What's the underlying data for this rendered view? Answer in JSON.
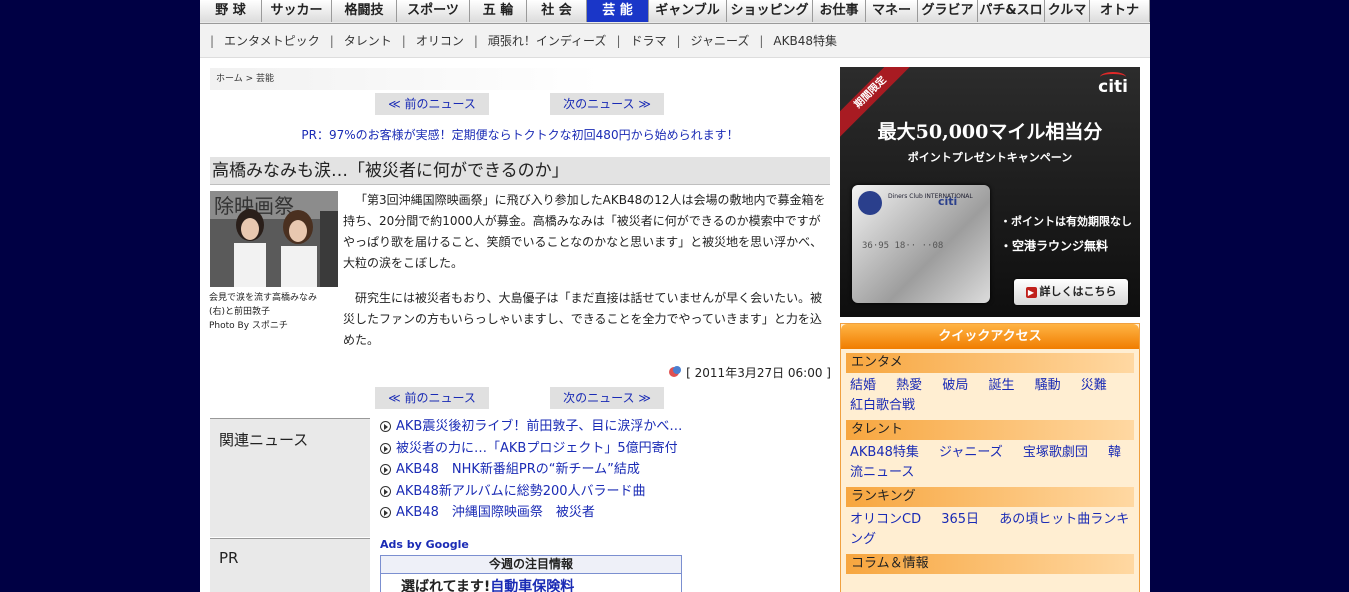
{
  "top_nav": [
    {
      "label": "野 球",
      "w": 62
    },
    {
      "label": "サッカー",
      "w": 70
    },
    {
      "label": "格闘技",
      "w": 65
    },
    {
      "label": "スポーツ",
      "w": 73
    },
    {
      "label": "五 輪",
      "w": 57
    },
    {
      "label": "社 会",
      "w": 60
    },
    {
      "label": "芸 能",
      "w": 62,
      "active": true
    },
    {
      "label": "ギャンブル",
      "w": 78
    },
    {
      "label": "ショッピング",
      "w": 86
    },
    {
      "label": "お仕事",
      "w": 53
    },
    {
      "label": "マネー",
      "w": 52
    },
    {
      "label": "グラビア",
      "w": 60
    },
    {
      "label": "パチ&スロ",
      "w": 67
    },
    {
      "label": "クルマ",
      "w": 45
    },
    {
      "label": "オトナ",
      "w": 60
    }
  ],
  "sub_nav": [
    "エンタメトピック",
    "タレント",
    "オリコン",
    "頑張れ！インディーズ",
    "ドラマ",
    "ジャニーズ",
    "AKB48特集"
  ],
  "breadcrumb": {
    "home": "ホーム",
    "sep": " > ",
    "current": "芸能"
  },
  "nav": {
    "prev": "≪ 前のニュース",
    "next": "次のニュース ≫"
  },
  "pr_line": "PR：97%のお客様が実感！定期便ならトクトクな初回480円から始められます！",
  "article": {
    "headline": "高橋みなみも涙…「被災者に何ができるのか」",
    "caption_1": "会見で涙を流す高橋みなみ",
    "caption_2": "(右)と前田敦子",
    "credit": "Photo By スポニチ",
    "para_1": "「第3回沖縄国際映画祭」に飛び入り参加したAKB48の12人は会場の敷地内で募金箱を持ち、20分間で約1000人が募金。高橋みなみは「被災者に何ができるのか模索中ですがやっぱり歌を届けること、笑顔でいることなのかなと思います」と被災地を思い浮かべ、大粒の涙をこぼした。",
    "para_2": "研究生には被災者もおり、大島優子は「まだ直接は話せていませんが早く会いたい。被災したファンの方もいらっしゃいますし、できることを全力でやっていきます」と力を込めた。",
    "date": "[ 2011年3月27日 06:00 ]"
  },
  "related": {
    "title": "関連ニュース",
    "items": [
      "AKB震災後初ライブ！前田敦子、目に涙浮かべ…",
      "被災者の力に…「AKBプロジェクト」5億円寄付",
      "AKB48　NHK新番組PRの“新チーム”結成",
      "AKB48新アルバムに総勢200人バラード曲",
      "AKB48　沖縄国際映画祭　被災者"
    ]
  },
  "pr_box": {
    "title": "PR"
  },
  "ads": {
    "by": "Ads by Google",
    "header": "今週の注目情報",
    "text_plain": "選ばれてます!",
    "text_link": "自動車保険料"
  },
  "banner": {
    "ribbon": "期間限定",
    "brand": "citi",
    "title": "最大50,000マイル相当分",
    "subtitle": "ポイントプレゼントキャンペーン",
    "card_brand": "Diners Club INTERNATIONAL",
    "card_num": "36·95  18··  ··08",
    "point_1": "・ポイントは有効期限なし",
    "point_2": "・空港ラウンジ無料",
    "more": "詳しくはこちら"
  },
  "quick_access": {
    "title": "クイックアクセス",
    "sections": [
      {
        "name": "エンタメ",
        "links": [
          "結婚",
          "熱愛",
          "破局",
          "誕生",
          "騒動",
          "災難",
          "紅白歌合戦"
        ]
      },
      {
        "name": "タレント",
        "links": [
          "AKB48特集",
          "ジャニーズ",
          "宝塚歌劇団",
          "韓流ニュース"
        ]
      },
      {
        "name": "ランキング",
        "links": [
          "オリコンCD",
          "365日",
          "あの頃ヒット曲ランキング"
        ]
      },
      {
        "name": "コラム＆情報",
        "links": []
      }
    ]
  },
  "colors": {
    "background": "#000044",
    "active_tab": "#1a36c8",
    "link": "#1a2bb5",
    "quick_access": "#f07d00"
  }
}
